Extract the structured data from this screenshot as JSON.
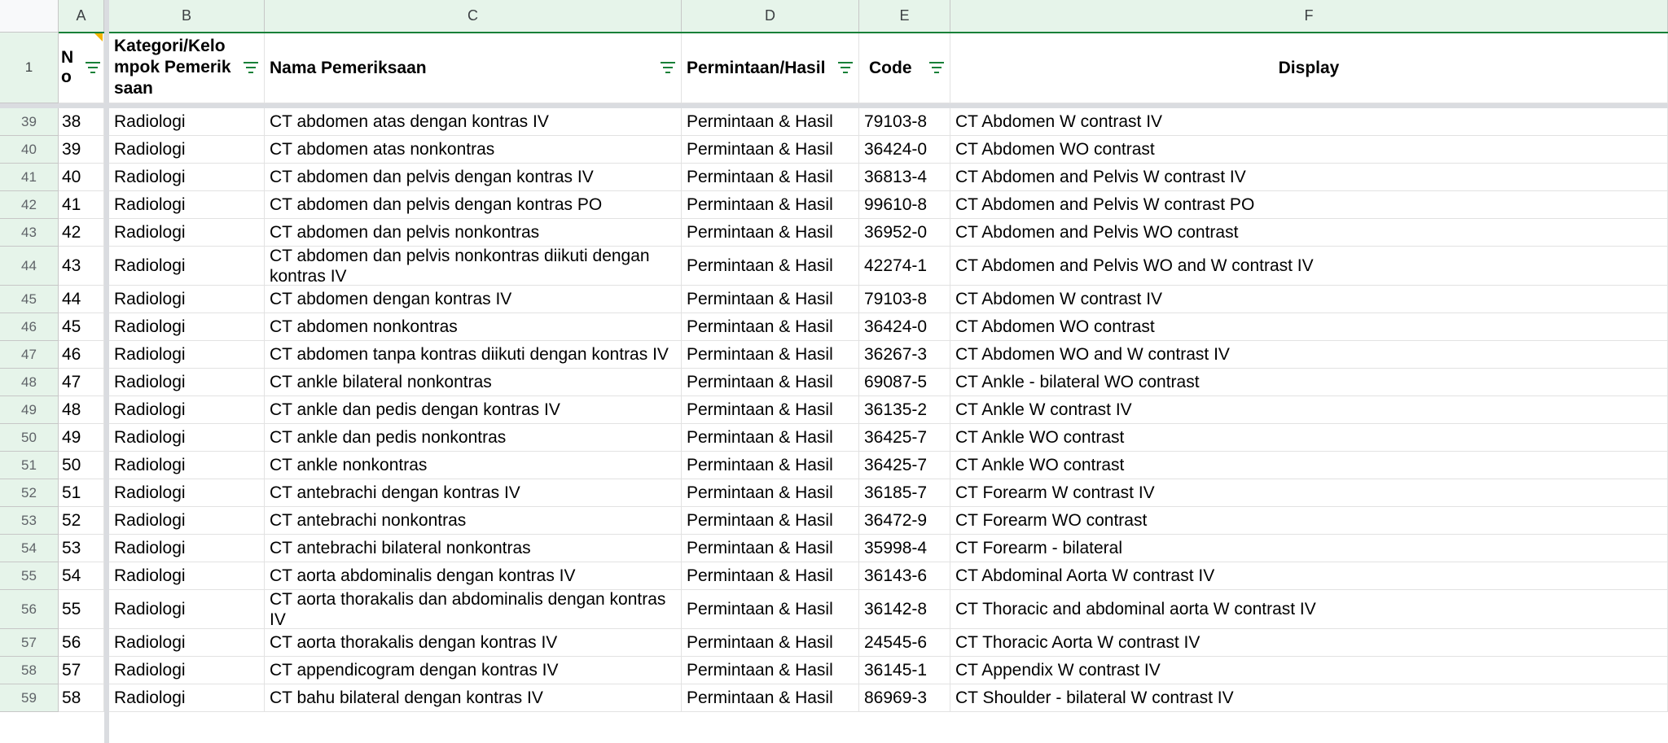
{
  "columns": [
    "A",
    "B",
    "C",
    "D",
    "E",
    "F"
  ],
  "header_row": {
    "row_number": "1",
    "no": "N\no",
    "kategori": "Kategori/Kelompok Pemeriksaan",
    "nama": "Nama Pemeriksaan",
    "permintaan": "Permintaan/Hasil",
    "code": "Code",
    "display": "Display"
  },
  "rows": [
    {
      "rn": "39",
      "no": "38",
      "kat": "Radiologi",
      "nama": "CT abdomen atas dengan kontras IV",
      "perm": "Permintaan & Hasil",
      "code": "79103-8",
      "display": "CT Abdomen W contrast IV"
    },
    {
      "rn": "40",
      "no": "39",
      "kat": "Radiologi",
      "nama": "CT abdomen atas nonkontras",
      "perm": "Permintaan & Hasil",
      "code": "36424-0",
      "display": "CT Abdomen WO contrast"
    },
    {
      "rn": "41",
      "no": "40",
      "kat": "Radiologi",
      "nama": "CT abdomen dan pelvis dengan kontras IV",
      "perm": "Permintaan & Hasil",
      "code": "36813-4",
      "display": "CT Abdomen and Pelvis W contrast IV"
    },
    {
      "rn": "42",
      "no": "41",
      "kat": "Radiologi",
      "nama": "CT abdomen dan pelvis dengan kontras PO",
      "perm": "Permintaan & Hasil",
      "code": "99610-8",
      "display": "CT Abdomen and Pelvis W contrast PO"
    },
    {
      "rn": "43",
      "no": "42",
      "kat": "Radiologi",
      "nama": "CT abdomen dan pelvis nonkontras",
      "perm": "Permintaan & Hasil",
      "code": "36952-0",
      "display": "CT Abdomen and Pelvis WO contrast"
    },
    {
      "rn": "44",
      "no": "43",
      "kat": "Radiologi",
      "nama": "CT abdomen dan pelvis nonkontras diikuti dengan kontras IV",
      "perm": "Permintaan & Hasil",
      "code": "42274-1",
      "display": "CT Abdomen and Pelvis WO and W contrast IV"
    },
    {
      "rn": "45",
      "no": "44",
      "kat": "Radiologi",
      "nama": "CT abdomen dengan kontras IV",
      "perm": "Permintaan & Hasil",
      "code": "79103-8",
      "display": "CT Abdomen W contrast IV"
    },
    {
      "rn": "46",
      "no": "45",
      "kat": "Radiologi",
      "nama": "CT abdomen nonkontras",
      "perm": "Permintaan & Hasil",
      "code": "36424-0",
      "display": "CT Abdomen WO contrast"
    },
    {
      "rn": "47",
      "no": "46",
      "kat": "Radiologi",
      "nama": "CT abdomen tanpa kontras diikuti dengan kontras IV",
      "perm": "Permintaan & Hasil",
      "code": "36267-3",
      "display": "CT Abdomen WO and W contrast IV"
    },
    {
      "rn": "48",
      "no": "47",
      "kat": "Radiologi",
      "nama": "CT ankle bilateral nonkontras",
      "perm": "Permintaan & Hasil",
      "code": "69087-5",
      "display": "CT Ankle - bilateral WO contrast"
    },
    {
      "rn": "49",
      "no": "48",
      "kat": "Radiologi",
      "nama": "CT ankle dan pedis dengan kontras IV",
      "perm": "Permintaan & Hasil",
      "code": "36135-2",
      "display": "CT Ankle W contrast IV"
    },
    {
      "rn": "50",
      "no": "49",
      "kat": "Radiologi",
      "nama": "CT ankle dan pedis nonkontras",
      "perm": "Permintaan & Hasil",
      "code": "36425-7",
      "display": "CT Ankle WO contrast"
    },
    {
      "rn": "51",
      "no": "50",
      "kat": "Radiologi",
      "nama": "CT ankle nonkontras",
      "perm": "Permintaan & Hasil",
      "code": "36425-7",
      "display": "CT Ankle WO contrast"
    },
    {
      "rn": "52",
      "no": "51",
      "kat": "Radiologi",
      "nama": "CT antebrachi dengan kontras IV",
      "perm": "Permintaan & Hasil",
      "code": "36185-7",
      "display": "CT Forearm W contrast IV"
    },
    {
      "rn": "53",
      "no": "52",
      "kat": "Radiologi",
      "nama": "CT antebrachi nonkontras",
      "perm": "Permintaan & Hasil",
      "code": "36472-9",
      "display": "CT Forearm WO contrast"
    },
    {
      "rn": "54",
      "no": "53",
      "kat": "Radiologi",
      "nama": "CT antebrachi bilateral nonkontras",
      "perm": "Permintaan & Hasil",
      "code": "35998-4",
      "display": "CT Forearm - bilateral"
    },
    {
      "rn": "55",
      "no": "54",
      "kat": "Radiologi",
      "nama": "CT aorta abdominalis dengan kontras IV",
      "perm": "Permintaan & Hasil",
      "code": "36143-6",
      "display": "CT Abdominal Aorta W contrast IV"
    },
    {
      "rn": "56",
      "no": "55",
      "kat": "Radiologi",
      "nama": "CT aorta thorakalis dan abdominalis dengan kontras IV",
      "perm": "Permintaan & Hasil",
      "code": "36142-8",
      "display": "CT Thoracic and abdominal aorta W contrast IV"
    },
    {
      "rn": "57",
      "no": "56",
      "kat": "Radiologi",
      "nama": "CT aorta thorakalis dengan kontras IV",
      "perm": "Permintaan & Hasil",
      "code": "24545-6",
      "display": "CT Thoracic Aorta W contrast IV"
    },
    {
      "rn": "58",
      "no": "57",
      "kat": "Radiologi",
      "nama": "CT appendicogram dengan kontras IV",
      "perm": "Permintaan & Hasil",
      "code": "36145-1",
      "display": "CT Appendix W contrast IV"
    },
    {
      "rn": "59",
      "no": "58",
      "kat": "Radiologi",
      "nama": "CT bahu bilateral dengan kontras IV",
      "perm": "Permintaan & Hasil",
      "code": "86969-3",
      "display": "CT Shoulder - bilateral W contrast IV"
    }
  ],
  "colors": {
    "header_bg": "#e6f4ea",
    "filter_icon": "#188038",
    "freeze_bar": "#dadce0"
  }
}
